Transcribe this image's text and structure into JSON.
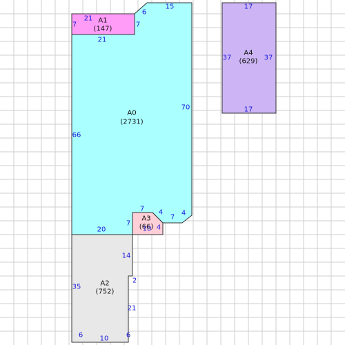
{
  "rooms": {
    "a0": {
      "name": "A0",
      "area": "(2731)",
      "fill": "#aaffff"
    },
    "a1": {
      "name": "A1",
      "area": "(147)",
      "fill": "#ff9cf7"
    },
    "a2": {
      "name": "A2",
      "area": "(752)",
      "fill": "#e8e8e8"
    },
    "a3": {
      "name": "A3",
      "area": "(66)",
      "fill": "#ffcfd8"
    },
    "a4": {
      "name": "A4",
      "area": "(629)",
      "fill": "#cdb5f5"
    }
  },
  "dimensions": {
    "a0_left": "66",
    "a0_right": "70",
    "a0_top": "15",
    "a0_bevel": "6",
    "a0_bottom": "20",
    "a0_lower_bevel": "4",
    "a1_left": "7",
    "a1_top": "21",
    "a1_right": "7",
    "a1_bottom": "21",
    "a3_top": "7",
    "a3_left": "7",
    "a3_bottom": "10",
    "a3_right": "4",
    "a3_bevel": "4",
    "a3_step": "7",
    "a2_left": "35",
    "a2_notch_top": "14",
    "a2_notch_step": "2",
    "a2_right": "21",
    "a2_bottom_left": "6",
    "a2_bottom": "10",
    "a2_bottom_right": "6",
    "a4_top": "17",
    "a4_bottom": "17",
    "a4_left": "37",
    "a4_right": "37"
  }
}
